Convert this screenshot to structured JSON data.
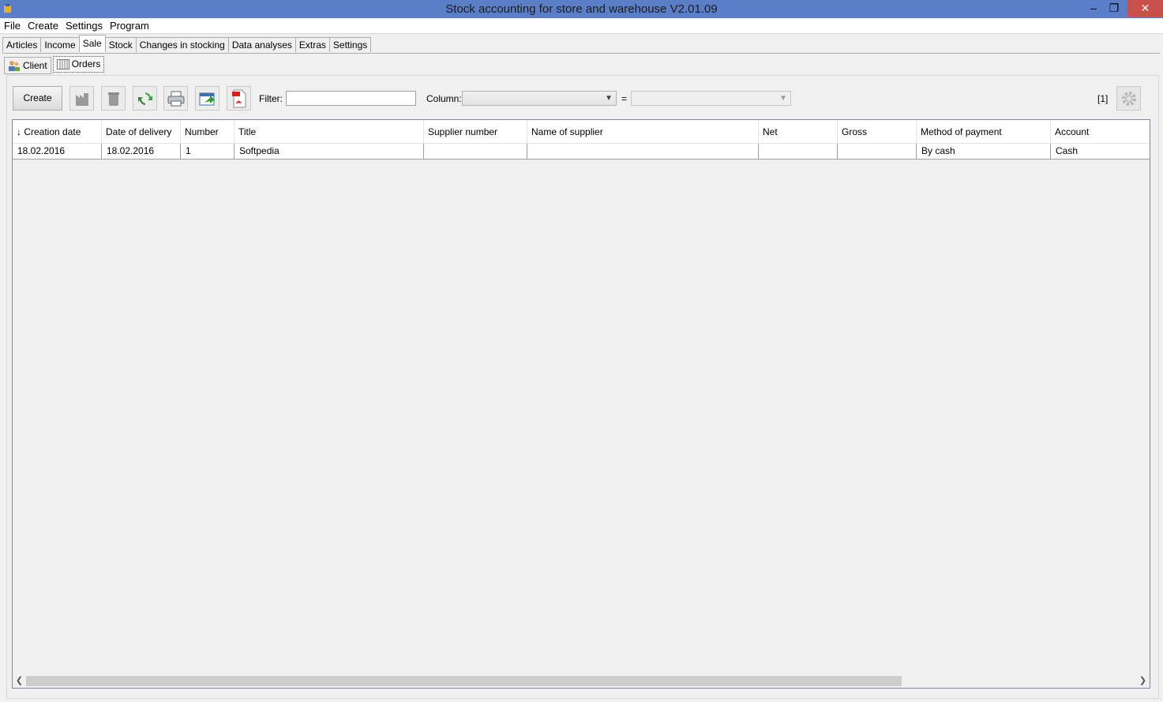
{
  "window": {
    "title": "Stock accounting for store and warehouse V2.01.09",
    "minimize": "‒",
    "maximize": "❐",
    "close": "✕"
  },
  "menu": [
    "File",
    "Create",
    "Settings",
    "Program"
  ],
  "tabs": [
    "Articles",
    "Income",
    "Sale",
    "Stock",
    "Changes in stocking",
    "Data analyses",
    "Extras",
    "Settings"
  ],
  "active_tab": "Sale",
  "subtabs": [
    "Client",
    "Orders"
  ],
  "active_subtab": "Orders",
  "toolbar": {
    "create_label": "Create",
    "filter_label": "Filter:",
    "filter_value": "",
    "column_label": "Column:",
    "column_value": "",
    "equals": "=",
    "value_value": "",
    "count": "[1]"
  },
  "grid": {
    "columns": [
      "↓ Creation date",
      "Date of delivery",
      "Number",
      "Title",
      "Supplier number",
      "Name of supplier",
      "Net",
      "Gross",
      "Method of payment",
      "Account"
    ],
    "rows": [
      [
        "18.02.2016",
        "18.02.2016",
        "1",
        "Softpedia",
        "",
        "",
        "",
        "",
        "By cash",
        "Cash"
      ]
    ]
  },
  "colors": {
    "titlebar": "#5b7fc7",
    "close": "#c7504a"
  }
}
